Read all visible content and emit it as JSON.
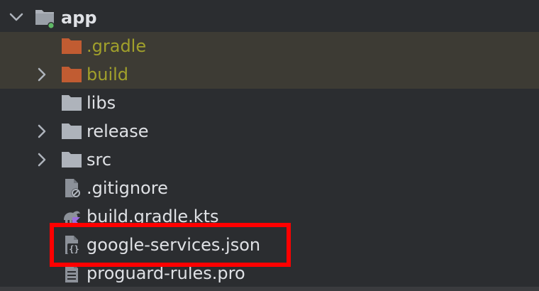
{
  "project_tree": {
    "root": {
      "label": "app",
      "icon": "module-folder-icon",
      "expanded": true
    },
    "items": [
      {
        "label": ".gradle",
        "icon": "folder-icon",
        "excluded": true,
        "expandable": false
      },
      {
        "label": "build",
        "icon": "folder-icon",
        "excluded": true,
        "expandable": true
      },
      {
        "label": "libs",
        "icon": "folder-icon",
        "excluded": false,
        "expandable": false
      },
      {
        "label": "release",
        "icon": "folder-icon",
        "excluded": false,
        "expandable": true
      },
      {
        "label": "src",
        "icon": "folder-icon",
        "excluded": false,
        "expandable": true
      },
      {
        "label": ".gitignore",
        "icon": "gitignore-file-icon"
      },
      {
        "label": "build.gradle.kts",
        "icon": "gradle-kotlin-file-icon"
      },
      {
        "label": "google-services.json",
        "icon": "json-file-icon",
        "highlighted": true
      },
      {
        "label": "proguard-rules.pro",
        "icon": "text-file-icon"
      }
    ]
  },
  "colors": {
    "background": "#2b2d30",
    "excluded_row": "#3d3b34",
    "excluded_text": "#a1a02b",
    "excluded_folder": "#c15c32",
    "folder": "#aeb3bb",
    "text": "#dfe1e5",
    "highlight": "#ff0000",
    "module_dot": "#5fb865"
  }
}
